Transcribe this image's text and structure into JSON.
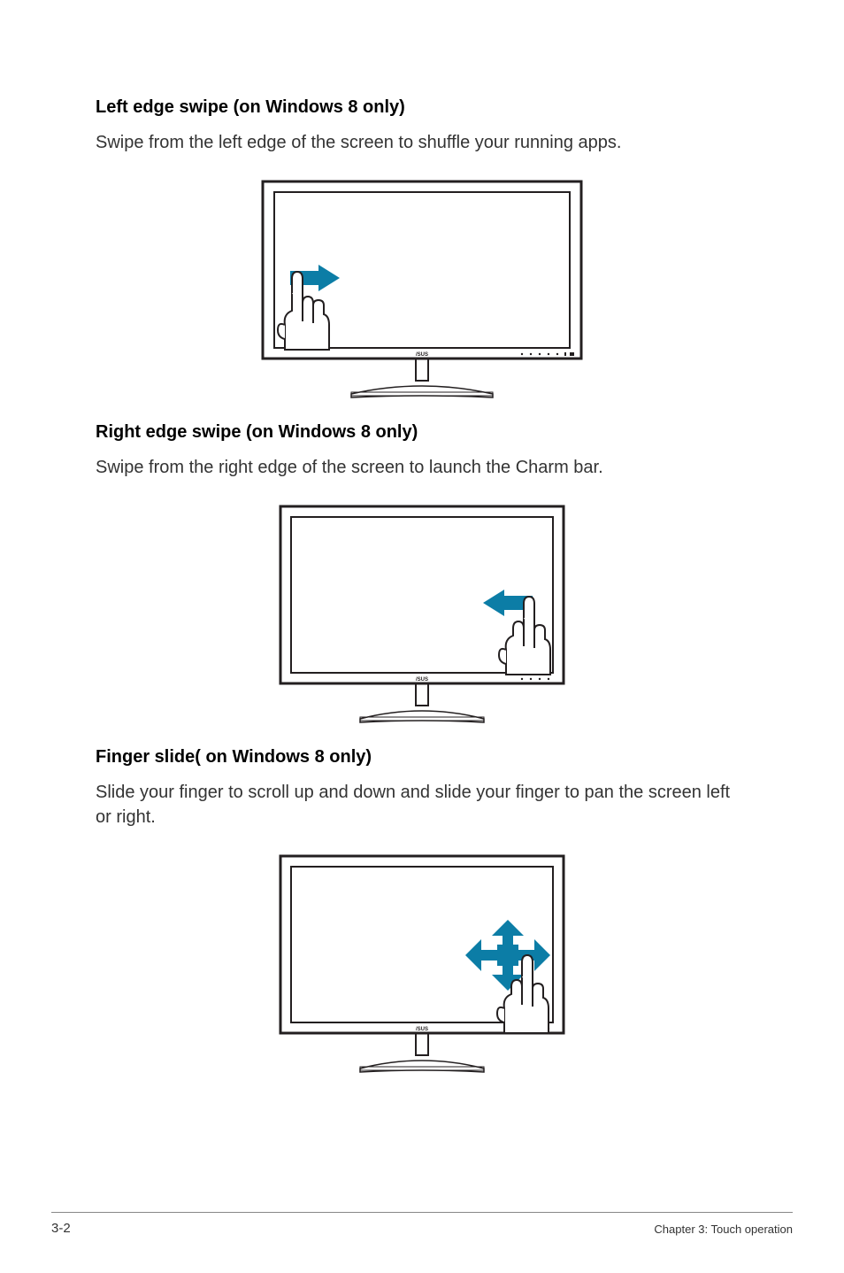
{
  "section1": {
    "heading": "Left edge swipe (on Windows 8 only)",
    "body": "Swipe from the left edge of the screen to shuffle your running apps."
  },
  "section2": {
    "heading": "Right edge swipe (on Windows 8 only)",
    "body": "Swipe from the right edge of the screen to launch the Charm bar."
  },
  "section3": {
    "heading": "Finger slide( on Windows 8 only)",
    "body": "Slide your finger to scroll up and down and slide your finger to pan the screen left or right."
  },
  "footer": {
    "page_number": "3-2",
    "chapter_label": "Chapter 3: Touch operation"
  },
  "colors": {
    "arrow": "#0c7da6",
    "stroke": "#231f20"
  }
}
